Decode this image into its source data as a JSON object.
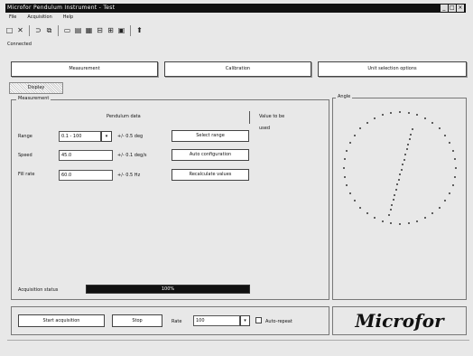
{
  "window": {
    "title": "Microfor Pendulum Instrument - Test",
    "min_label": "_",
    "max_label": "□",
    "close_label": "×"
  },
  "menu": {
    "items": [
      "File",
      "Acquisition",
      "Help"
    ]
  },
  "toolbar": {
    "icons": [
      "new-icon",
      "close-icon",
      "open-icon",
      "copy-icon",
      "record-icon",
      "chart-icon",
      "table-icon",
      "export-icon",
      "import-icon",
      "print-icon",
      "upload-icon"
    ]
  },
  "status_line": "Connected",
  "top_buttons": {
    "b1": "Measurement",
    "b2": "Calibration",
    "b3": "Unit selection options"
  },
  "subtab": "Display",
  "params_group": {
    "label": "Measurement",
    "header": "Pendulum data",
    "right_note_1": "Value to be",
    "right_note_2": "used",
    "rows": [
      {
        "label": "Range",
        "value": "0.1 - 100",
        "unit": "+/- 0.5 deg",
        "button": "Select range"
      },
      {
        "label": "Speed",
        "value": "45.0",
        "unit": "+/- 0.1 deg/s",
        "button": "Auto configuration"
      },
      {
        "label": "Fill rate",
        "value": "60.0",
        "unit": "+/- 0.5 Hz",
        "button": "Recalculate values"
      }
    ],
    "progress_label": "Acquisition status",
    "progress_value": "100%",
    "progress_fraction": 1.0
  },
  "gauge_group": {
    "label": "Angle"
  },
  "bottom": {
    "start_button": "Start acquisition",
    "stop_button": "Stop",
    "rate_label": "Rate",
    "rate_value": "100",
    "checkbox_label": "Auto-repeat"
  },
  "logo": "Microfor"
}
